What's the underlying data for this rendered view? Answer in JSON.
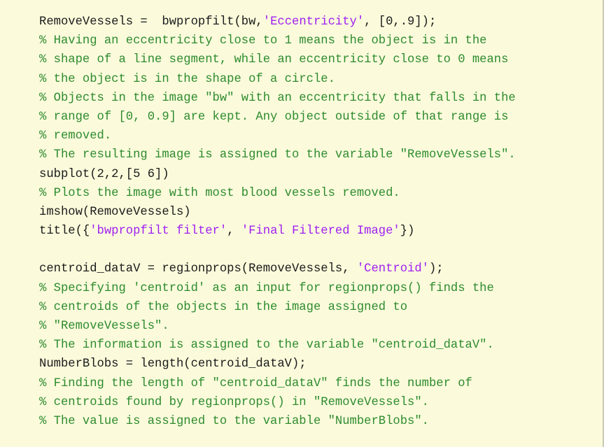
{
  "editor": {
    "app": "matlab-code-editor",
    "language": "MATLAB",
    "colors": {
      "background": "#fbfbdc",
      "text": "#1b1b1b",
      "comment": "#2e8b2e",
      "string": "#a020f0",
      "border": "#c9c9b4"
    },
    "lines": [
      {
        "index": 1,
        "text": "RemoveVessels =  bwpropfilt(bw,'Eccentricity', [0,.9]);",
        "tokens": [
          {
            "t": "RemoveVessels =  bwpropfilt(bw,",
            "k": "plain"
          },
          {
            "t": "'Eccentricity'",
            "k": "string"
          },
          {
            "t": ", [0,.9]);",
            "k": "plain"
          }
        ]
      },
      {
        "index": 2,
        "text": "% Having an eccentricity close to 1 means the object is in the",
        "tokens": [
          {
            "t": "% Having an eccentricity close to 1 means the object is in the",
            "k": "comment"
          }
        ]
      },
      {
        "index": 3,
        "text": "% shape of a line segment, while an eccentricity close to 0 means",
        "tokens": [
          {
            "t": "% shape of a line segment, while an eccentricity close to 0 means",
            "k": "comment"
          }
        ]
      },
      {
        "index": 4,
        "text": "% the object is in the shape of a circle.",
        "tokens": [
          {
            "t": "% the object is in the shape of a circle.",
            "k": "comment"
          }
        ]
      },
      {
        "index": 5,
        "text": "% Objects in the image \"bw\" with an eccentricity that falls in the",
        "tokens": [
          {
            "t": "% Objects in the image \"bw\" with an eccentricity that falls in the",
            "k": "comment"
          }
        ]
      },
      {
        "index": 6,
        "text": "% range of [0, 0.9] are kept. Any object outside of that range is",
        "tokens": [
          {
            "t": "% range of [0, 0.9] are kept. Any object outside of that range is",
            "k": "comment"
          }
        ]
      },
      {
        "index": 7,
        "text": "% removed.",
        "tokens": [
          {
            "t": "% removed.",
            "k": "comment"
          }
        ]
      },
      {
        "index": 8,
        "text": "% The resulting image is assigned to the variable \"RemoveVessels\".",
        "tokens": [
          {
            "t": "% The resulting image is assigned to the variable \"RemoveVessels\".",
            "k": "comment"
          }
        ]
      },
      {
        "index": 9,
        "text": "subplot(2,2,[5 6])",
        "tokens": [
          {
            "t": "subplot(2,2,[5 6])",
            "k": "plain"
          }
        ]
      },
      {
        "index": 10,
        "text": "% Plots the image with most blood vessels removed.",
        "tokens": [
          {
            "t": "% Plots the image with most blood vessels removed.",
            "k": "comment"
          }
        ]
      },
      {
        "index": 11,
        "text": "imshow(RemoveVessels)",
        "tokens": [
          {
            "t": "imshow(RemoveVessels)",
            "k": "plain"
          }
        ]
      },
      {
        "index": 12,
        "text": "title({'bwpropfilt filter', 'Final Filtered Image'})",
        "tokens": [
          {
            "t": "title({",
            "k": "plain"
          },
          {
            "t": "'bwpropfilt filter'",
            "k": "string"
          },
          {
            "t": ", ",
            "k": "plain"
          },
          {
            "t": "'Final Filtered Image'",
            "k": "string"
          },
          {
            "t": "})",
            "k": "plain"
          }
        ]
      },
      {
        "index": 13,
        "text": "",
        "tokens": []
      },
      {
        "index": 14,
        "text": "centroid_dataV = regionprops(RemoveVessels, 'Centroid');",
        "tokens": [
          {
            "t": "centroid_dataV = regionprops(RemoveVessels, ",
            "k": "plain"
          },
          {
            "t": "'Centroid'",
            "k": "string"
          },
          {
            "t": ");",
            "k": "plain"
          }
        ]
      },
      {
        "index": 15,
        "text": "% Specifying 'centroid' as an input for regionprops() finds the",
        "tokens": [
          {
            "t": "% Specifying 'centroid' as an input for regionprops() finds the",
            "k": "comment"
          }
        ]
      },
      {
        "index": 16,
        "text": "% centroids of the objects in the image assigned to",
        "tokens": [
          {
            "t": "% centroids of the objects in the image assigned to",
            "k": "comment"
          }
        ]
      },
      {
        "index": 17,
        "text": "% \"RemoveVessels\".",
        "tokens": [
          {
            "t": "% \"RemoveVessels\".",
            "k": "comment"
          }
        ]
      },
      {
        "index": 18,
        "text": "% The information is assigned to the variable \"centroid_dataV\".",
        "tokens": [
          {
            "t": "% The information is assigned to the variable \"centroid_dataV\".",
            "k": "comment"
          }
        ]
      },
      {
        "index": 19,
        "text": "NumberBlobs = length(centroid_dataV);",
        "tokens": [
          {
            "t": "NumberBlobs = length(centroid_dataV);",
            "k": "plain"
          }
        ]
      },
      {
        "index": 20,
        "text": "% Finding the length of \"centroid_dataV\" finds the number of",
        "tokens": [
          {
            "t": "% Finding the length of \"centroid_dataV\" finds the number of",
            "k": "comment"
          }
        ]
      },
      {
        "index": 21,
        "text": "% centroids found by regionprops() in \"RemoveVessels\".",
        "tokens": [
          {
            "t": "% centroids found by regionprops() in \"RemoveVessels\".",
            "k": "comment"
          }
        ]
      },
      {
        "index": 22,
        "text": "% The value is assigned to the variable \"NumberBlobs\".",
        "tokens": [
          {
            "t": "% The value is assigned to the variable \"NumberBlobs\".",
            "k": "comment"
          }
        ]
      }
    ]
  }
}
